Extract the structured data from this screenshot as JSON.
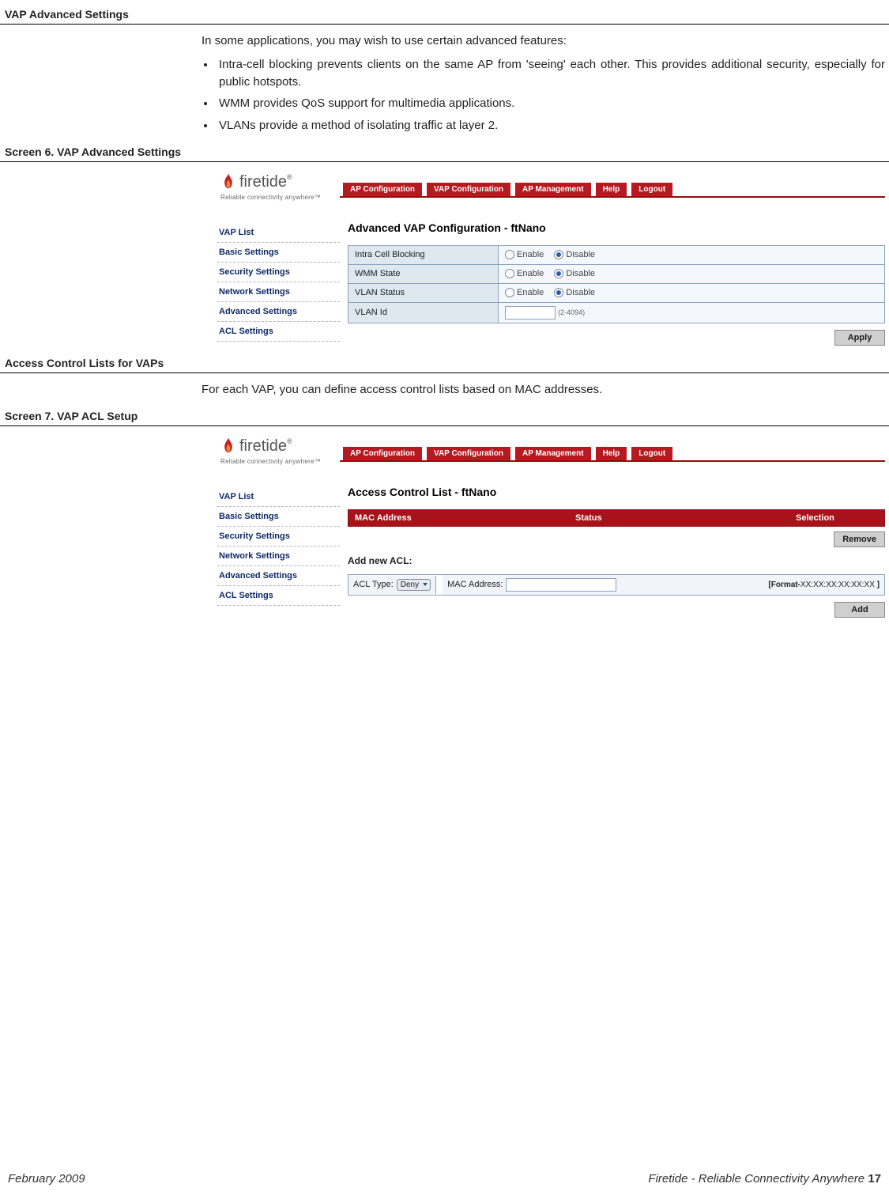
{
  "sections": {
    "advanced": {
      "heading": "VAP Advanced Settings",
      "intro": "In some applications, you may wish to use certain advanced features:",
      "bullets": [
        "Intra-cell blocking prevents clients on the same AP from 'seeing' each other. This provides additional security, especially for public hotspots.",
        "WMM provides QoS support for multimedia applications.",
        "VLANs provide a method of isolating traffic at layer 2."
      ]
    },
    "acl": {
      "heading": "Access Control Lists for VAPs",
      "intro": "For each VAP, you can define access control lists based on MAC addresses."
    }
  },
  "brand": {
    "name": "firetide",
    "reg": "®",
    "tagline": "Reliable connectivity anywhere™"
  },
  "tabs": {
    "ap_config": "AP Configuration",
    "vap_config": "VAP Configuration",
    "ap_mgmt": "AP Management",
    "help": "Help",
    "logout": "Logout"
  },
  "side_links": {
    "vap_list": "VAP List",
    "basic": "Basic Settings",
    "security": "Security Settings",
    "network": "Network Settings",
    "advanced": "Advanced Settings",
    "acl": "ACL Settings"
  },
  "screen6": {
    "caption": "Screen 6. VAP Advanced Settings",
    "panel_title": "Advanced VAP Configuration - ftNano",
    "rows": {
      "intra_cell": {
        "label": "Intra Cell Blocking",
        "enable": "Enable",
        "disable": "Disable",
        "selected": "disable"
      },
      "wmm": {
        "label": "WMM State",
        "enable": "Enable",
        "disable": "Disable",
        "selected": "disable"
      },
      "vlan_stat": {
        "label": "VLAN Status",
        "enable": "Enable",
        "disable": "Disable",
        "selected": "disable"
      },
      "vlan_id": {
        "label": "VLAN Id",
        "placeholder": "(2-4094)"
      }
    },
    "apply_btn": "Apply"
  },
  "screen7": {
    "caption": "Screen 7. VAP ACL Setup",
    "panel_title": "Access Control List - ftNano",
    "header": {
      "mac": "MAC Address",
      "status": "Status",
      "selection": "Selection"
    },
    "remove_btn": "Remove",
    "add_heading": "Add new ACL:",
    "acl_type_label": "ACL Type:",
    "acl_type_value": "Deny",
    "mac_label": "MAC Address:",
    "format_hint_prefix": "[Format-",
    "format_hint_value": "XX:XX:XX:XX:XX:XX",
    "format_hint_suffix": " ]",
    "add_btn": "Add"
  },
  "footer": {
    "left": "February 2009",
    "right_text": "Firetide - Reliable Connectivity Anywhere ",
    "page_num": "17"
  }
}
